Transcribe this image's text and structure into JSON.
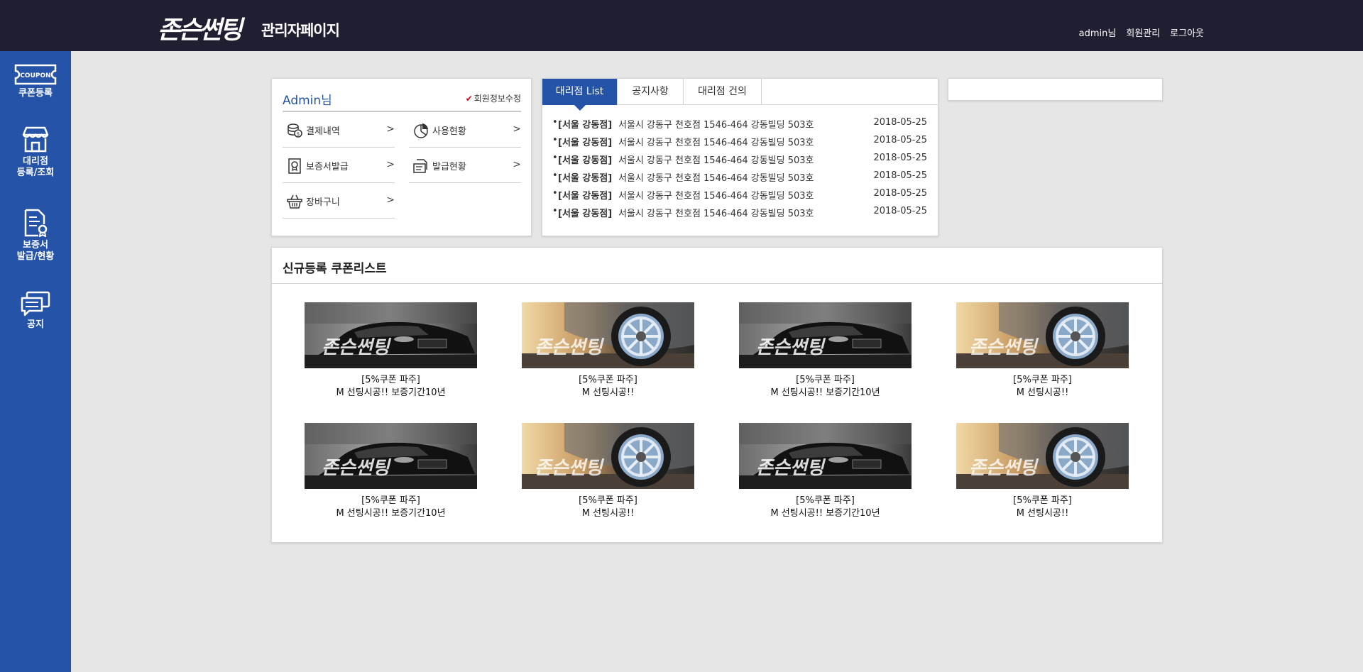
{
  "header": {
    "logo": "존슨썬팅",
    "title": "관리자페이지",
    "links": [
      "admin님",
      "회원관리",
      "로그아웃"
    ]
  },
  "sidebar": {
    "items": [
      {
        "label": "쿠폰등록",
        "icon": "coupon-icon"
      },
      {
        "label": "대리점\n등록/조회",
        "label_line1": "대리점",
        "label_line2": "등록/조회",
        "icon": "store-icon"
      },
      {
        "label_line1": "보증서",
        "label_line2": "발급/현황",
        "icon": "certificate-icon"
      },
      {
        "label": "공지",
        "icon": "chat-icon"
      }
    ],
    "coupon_icon_text": "COUPON"
  },
  "user_panel": {
    "name": "Admin님",
    "edit_label": "회원정보수정",
    "menu": [
      {
        "label": "결제내역",
        "icon": "coins-icon"
      },
      {
        "label": "사용현황",
        "icon": "pie-chart-icon"
      },
      {
        "label": "보증서발급",
        "icon": "certificate-icon"
      },
      {
        "label": "발급현황",
        "icon": "document-icon"
      },
      {
        "label": "장바구니",
        "icon": "basket-icon"
      }
    ],
    "arrow": ">"
  },
  "board": {
    "tabs": [
      "대리점 List",
      "공지사항",
      "대리점 건의"
    ],
    "active_tab": "대리점 List",
    "rows": [
      {
        "branch": "[서울 강동점]",
        "address": "서울시 강동구 천호점 1546-464 강동빌딩 503호",
        "date": "2018-05-25"
      },
      {
        "branch": "[서울 강동점]",
        "address": "서울시 강동구 천호점 1546-464 강동빌딩 503호",
        "date": "2018-05-25"
      },
      {
        "branch": "[서울 강동점]",
        "address": "서울시 강동구 천호점 1546-464 강동빌딩 503호",
        "date": "2018-05-25"
      },
      {
        "branch": "[서울 강동점]",
        "address": "서울시 강동구 천호점 1546-464 강동빌딩 503호",
        "date": "2018-05-25"
      },
      {
        "branch": "[서울 강동점]",
        "address": "서울시 강동구 천호점 1546-464 강동빌딩 503호",
        "date": "2018-05-25"
      },
      {
        "branch": "[서울 강동점]",
        "address": "서울시 강동구 천호점 1546-464 강동빌딩 503호",
        "date": "2018-05-25"
      }
    ]
  },
  "coupons": {
    "title": "신규등록 쿠폰리스트",
    "items": [
      {
        "banner": "존슨썬팅",
        "line1": "[5%쿠폰 파주]",
        "line2": "M 선팅시공!! 보증기간10년",
        "image": "black-car"
      },
      {
        "banner": "존슨썬팅",
        "line1": "[5%쿠폰 파주]",
        "line2": "M 선팅시공!!",
        "image": "wheel"
      },
      {
        "banner": "존슨썬팅",
        "line1": "[5%쿠폰 파주]",
        "line2": "M 선팅시공!! 보증기간10년",
        "image": "black-car"
      },
      {
        "banner": "존슨썬팅",
        "line1": "[5%쿠폰 파주]",
        "line2": "M 선팅시공!!",
        "image": "wheel"
      },
      {
        "banner": "존슨썬팅",
        "line1": "[5%쿠폰 파주]",
        "line2": "M 선팅시공!! 보증기간10년",
        "image": "black-car"
      },
      {
        "banner": "존슨썬팅",
        "line1": "[5%쿠폰 파주]",
        "line2": "M 선팅시공!!",
        "image": "wheel"
      },
      {
        "banner": "존슨썬팅",
        "line1": "[5%쿠폰 파주]",
        "line2": "M 선팅시공!! 보증기간10년",
        "image": "black-car"
      },
      {
        "banner": "존슨썬팅",
        "line1": "[5%쿠폰 파주]",
        "line2": "M 선팅시공!!",
        "image": "wheel"
      }
    ]
  },
  "colors": {
    "header_bg": "#201e31",
    "sidebar_bg": "#2453a8",
    "accent": "#2453a8",
    "page_bg": "#e6e6e6"
  }
}
